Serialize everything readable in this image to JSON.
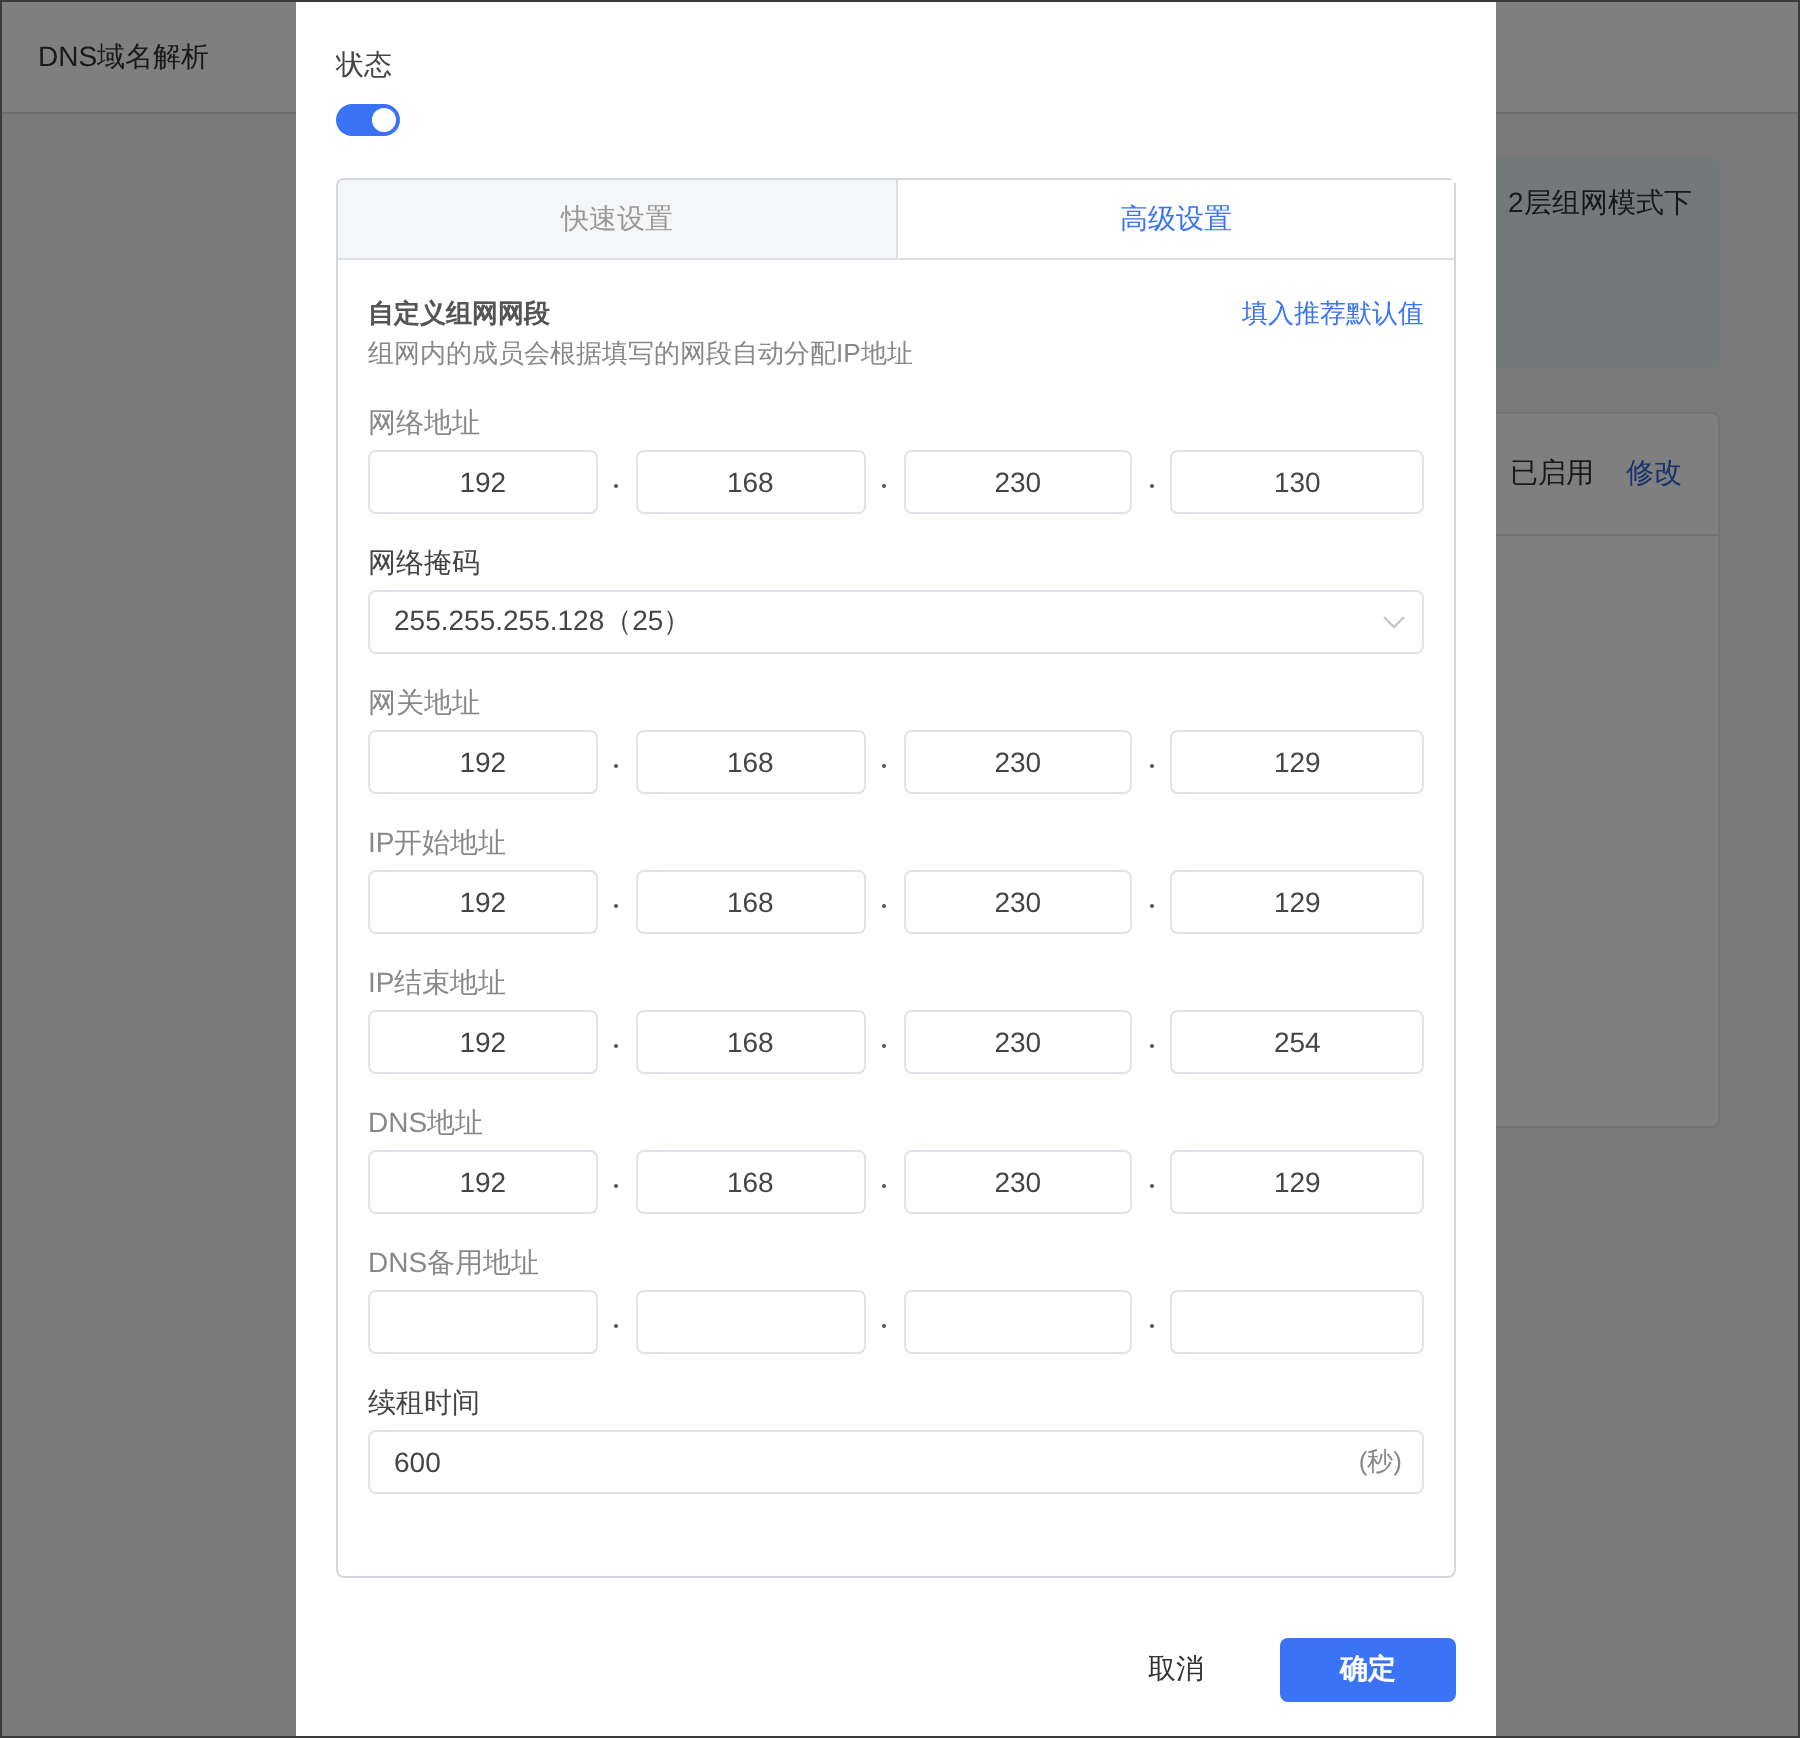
{
  "background": {
    "tabs": [
      {
        "label": "DNS域名解析"
      }
    ],
    "notice": "2层组网模式下",
    "status": "已启用",
    "edit_link": "修改"
  },
  "dialog": {
    "status_label": "状态",
    "status_on": true,
    "tabs": [
      {
        "label": "快速设置",
        "selected": false
      },
      {
        "label": "高级设置",
        "selected": true
      }
    ],
    "section": {
      "title": "自定义组网网段",
      "description": "组网内的成员会根据填写的网段自动分配IP地址",
      "fill_link": "填入推荐默认值"
    },
    "fields": [
      {
        "kind": "ip",
        "label": "网络地址",
        "octets": [
          "192",
          "168",
          "230",
          "130"
        ]
      },
      {
        "kind": "select",
        "label": "网络掩码",
        "value": "255.255.255.128（25）"
      },
      {
        "kind": "ip",
        "label": "网关地址",
        "octets": [
          "192",
          "168",
          "230",
          "129"
        ]
      },
      {
        "kind": "ip",
        "label": "IP开始地址",
        "octets": [
          "192",
          "168",
          "230",
          "129"
        ]
      },
      {
        "kind": "ip",
        "label": "IP结束地址",
        "octets": [
          "192",
          "168",
          "230",
          "254"
        ]
      },
      {
        "kind": "ip",
        "label": "DNS地址",
        "octets": [
          "192",
          "168",
          "230",
          "129"
        ]
      },
      {
        "kind": "ip",
        "label": "DNS备用地址"
      },
      {
        "kind": "number",
        "label": "续租时间",
        "value": "600",
        "unit": "(秒)"
      }
    ],
    "buttons": [
      {
        "kind": "secondary",
        "label": "取消"
      },
      {
        "kind": "primary",
        "label": "确定"
      }
    ]
  }
}
